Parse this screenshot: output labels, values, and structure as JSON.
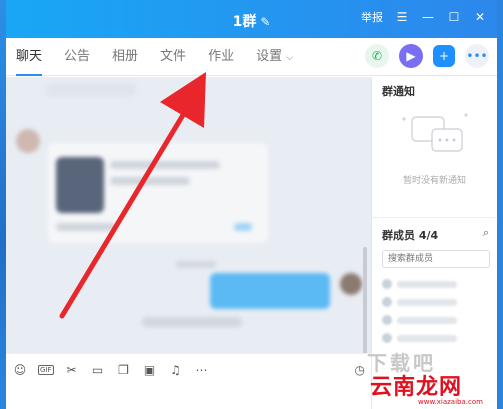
{
  "window": {
    "title": "1群",
    "report_label": "举报"
  },
  "tabs": [
    {
      "label": "聊天",
      "active": true
    },
    {
      "label": "公告",
      "active": false
    },
    {
      "label": "相册",
      "active": false
    },
    {
      "label": "文件",
      "active": false
    },
    {
      "label": "作业",
      "active": false
    },
    {
      "label": "设置",
      "active": false
    }
  ],
  "sidebar": {
    "notice_title": "群通知",
    "notice_empty": "暂时没有新通知",
    "members_title": "群成员 4/4",
    "member_search_placeholder": "搜索群成员"
  },
  "watermark": {
    "back_text": "下载吧",
    "brand": "云南龙网",
    "url": "www.xiazaiba.com"
  },
  "colors": {
    "accent": "#2d8cf0",
    "annotation_arrow": "#e8262b"
  }
}
